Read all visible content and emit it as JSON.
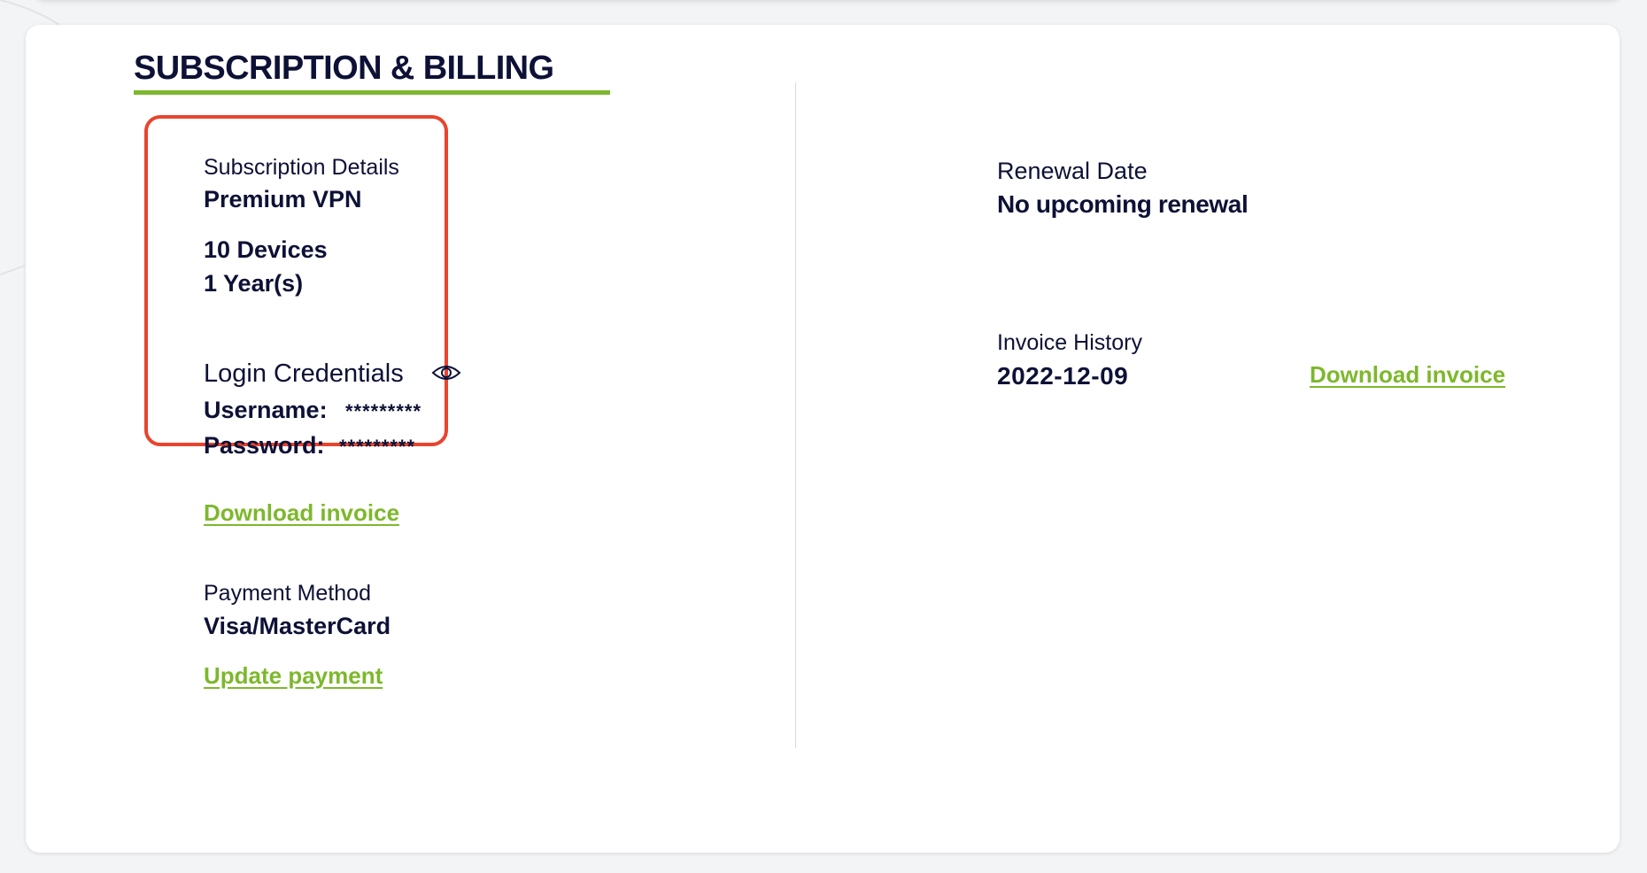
{
  "section": {
    "title": "SUBSCRIPTION & BILLING"
  },
  "subscription": {
    "label": "Subscription Details",
    "plan": "Premium VPN",
    "devices": "10 Devices",
    "duration": "1 Year(s)"
  },
  "credentials": {
    "title": "Login Credentials",
    "icon": "eye-icon",
    "username_label": "Username:",
    "username_value": "*********",
    "password_label": "Password:",
    "password_value": "*********"
  },
  "subscription_actions": {
    "download_invoice": "Download invoice"
  },
  "payment": {
    "label": "Payment Method",
    "value": "Visa/MasterCard",
    "update_link": "Update payment"
  },
  "renewal": {
    "label": "Renewal Date",
    "value": "No upcoming renewal"
  },
  "invoice_history": {
    "label": "Invoice History",
    "entries": [
      {
        "date": "2022-12-09",
        "link": "Download invoice"
      }
    ]
  },
  "colors": {
    "accent_green": "#7db82c",
    "highlight_red": "#e8442e",
    "text_navy": "#0d1136"
  }
}
